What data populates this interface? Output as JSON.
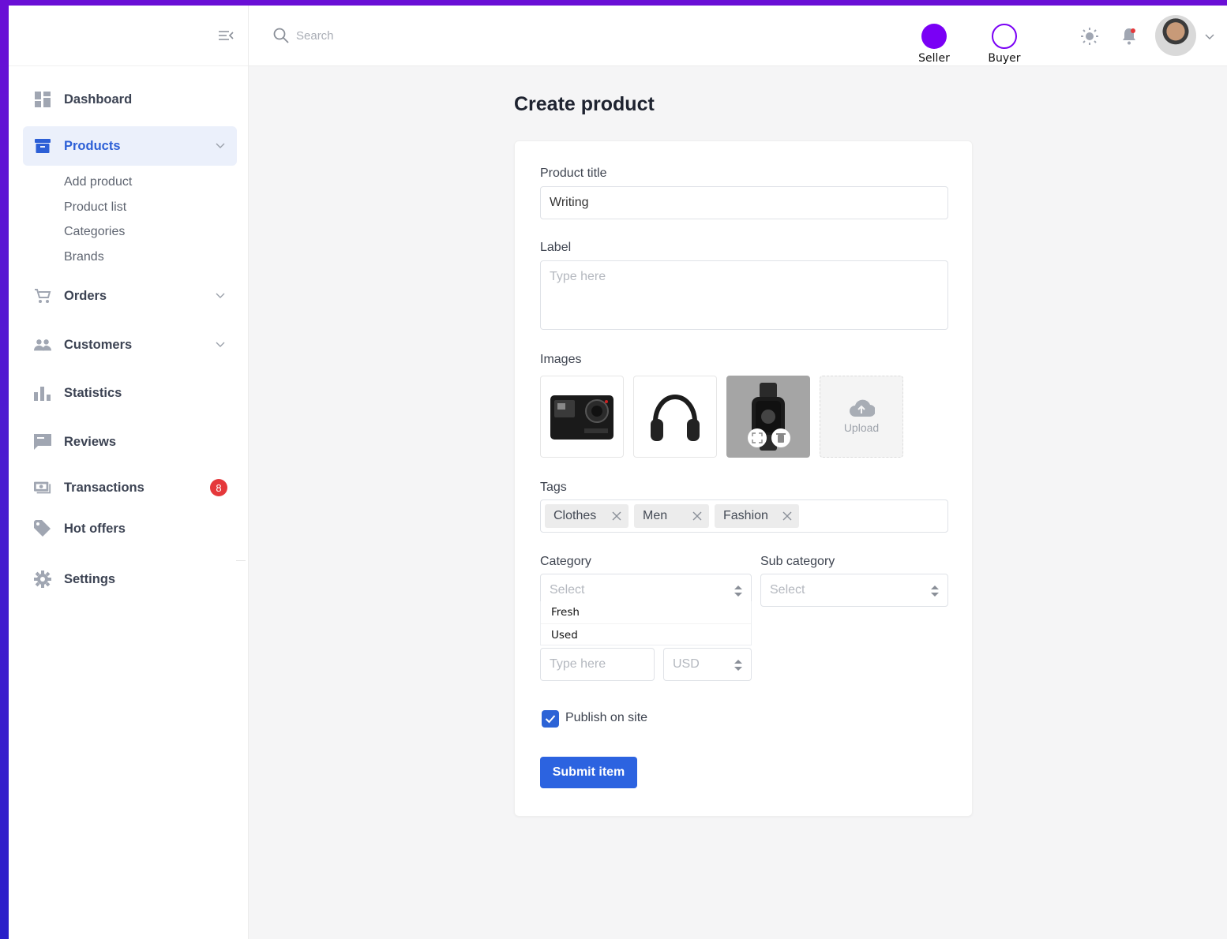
{
  "colors": {
    "accent": "#2c63e0",
    "sidebar_active_bg": "#ebf0fb",
    "seller_dot": "#7a00f5",
    "buyer_ring": "#7a00f5",
    "badge": "#e5383b"
  },
  "header": {
    "search_placeholder": "Search",
    "roles": [
      {
        "label": "Seller",
        "selected": true
      },
      {
        "label": "Buyer",
        "selected": false
      }
    ],
    "icons": [
      "sun-icon",
      "bell-icon"
    ]
  },
  "sidebar": {
    "items": [
      {
        "label": "Dashboard",
        "icon": "dashboard-icon"
      },
      {
        "label": "Products",
        "icon": "archive-icon",
        "active": true,
        "expanded": true,
        "sub_items": [
          "Add product",
          "Product list",
          "Categories",
          "Brands"
        ]
      },
      {
        "label": "Orders",
        "icon": "cart-icon"
      },
      {
        "label": "Customers",
        "icon": "people-icon"
      },
      {
        "label": "Statistics",
        "icon": "bar-chart-icon"
      },
      {
        "label": "Reviews",
        "icon": "comment-icon"
      },
      {
        "label": "Transactions",
        "icon": "money-icon",
        "badge": "8"
      },
      {
        "label": "Hot offers",
        "icon": "tag-icon"
      },
      {
        "label": "Settings",
        "icon": "gear-icon"
      }
    ]
  },
  "page": {
    "title": "Create product"
  },
  "form": {
    "product_title": {
      "label": "Product title",
      "value": "Writing"
    },
    "label_field": {
      "label": "Label",
      "placeholder": "Type here"
    },
    "images": {
      "label": "Images",
      "items": [
        "camera-image",
        "headphones-image",
        "smartwatch-image"
      ],
      "upload_label": "Upload"
    },
    "tags": {
      "label": "Tags",
      "items": [
        "Clothes",
        "Men",
        "Fashion"
      ]
    },
    "category": {
      "label": "Category",
      "placeholder": "Select",
      "options": [
        "Fresh",
        "Used"
      ]
    },
    "sub_category": {
      "label": "Sub category",
      "placeholder": "Select"
    },
    "price": {
      "placeholder": "Type here",
      "currency": "USD"
    },
    "publish": {
      "label": "Publish on site",
      "checked": true
    },
    "submit_label": "Submit item"
  }
}
